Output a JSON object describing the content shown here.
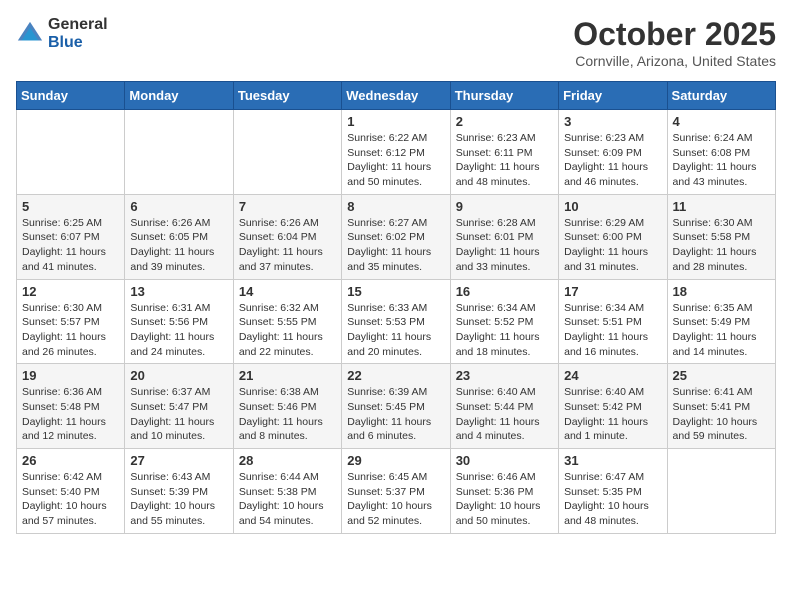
{
  "logo": {
    "general": "General",
    "blue": "Blue"
  },
  "title": "October 2025",
  "location": "Cornville, Arizona, United States",
  "days_of_week": [
    "Sunday",
    "Monday",
    "Tuesday",
    "Wednesday",
    "Thursday",
    "Friday",
    "Saturday"
  ],
  "weeks": [
    [
      {
        "day": "",
        "info": ""
      },
      {
        "day": "",
        "info": ""
      },
      {
        "day": "",
        "info": ""
      },
      {
        "day": "1",
        "info": "Sunrise: 6:22 AM\nSunset: 6:12 PM\nDaylight: 11 hours\nand 50 minutes."
      },
      {
        "day": "2",
        "info": "Sunrise: 6:23 AM\nSunset: 6:11 PM\nDaylight: 11 hours\nand 48 minutes."
      },
      {
        "day": "3",
        "info": "Sunrise: 6:23 AM\nSunset: 6:09 PM\nDaylight: 11 hours\nand 46 minutes."
      },
      {
        "day": "4",
        "info": "Sunrise: 6:24 AM\nSunset: 6:08 PM\nDaylight: 11 hours\nand 43 minutes."
      }
    ],
    [
      {
        "day": "5",
        "info": "Sunrise: 6:25 AM\nSunset: 6:07 PM\nDaylight: 11 hours\nand 41 minutes."
      },
      {
        "day": "6",
        "info": "Sunrise: 6:26 AM\nSunset: 6:05 PM\nDaylight: 11 hours\nand 39 minutes."
      },
      {
        "day": "7",
        "info": "Sunrise: 6:26 AM\nSunset: 6:04 PM\nDaylight: 11 hours\nand 37 minutes."
      },
      {
        "day": "8",
        "info": "Sunrise: 6:27 AM\nSunset: 6:02 PM\nDaylight: 11 hours\nand 35 minutes."
      },
      {
        "day": "9",
        "info": "Sunrise: 6:28 AM\nSunset: 6:01 PM\nDaylight: 11 hours\nand 33 minutes."
      },
      {
        "day": "10",
        "info": "Sunrise: 6:29 AM\nSunset: 6:00 PM\nDaylight: 11 hours\nand 31 minutes."
      },
      {
        "day": "11",
        "info": "Sunrise: 6:30 AM\nSunset: 5:58 PM\nDaylight: 11 hours\nand 28 minutes."
      }
    ],
    [
      {
        "day": "12",
        "info": "Sunrise: 6:30 AM\nSunset: 5:57 PM\nDaylight: 11 hours\nand 26 minutes."
      },
      {
        "day": "13",
        "info": "Sunrise: 6:31 AM\nSunset: 5:56 PM\nDaylight: 11 hours\nand 24 minutes."
      },
      {
        "day": "14",
        "info": "Sunrise: 6:32 AM\nSunset: 5:55 PM\nDaylight: 11 hours\nand 22 minutes."
      },
      {
        "day": "15",
        "info": "Sunrise: 6:33 AM\nSunset: 5:53 PM\nDaylight: 11 hours\nand 20 minutes."
      },
      {
        "day": "16",
        "info": "Sunrise: 6:34 AM\nSunset: 5:52 PM\nDaylight: 11 hours\nand 18 minutes."
      },
      {
        "day": "17",
        "info": "Sunrise: 6:34 AM\nSunset: 5:51 PM\nDaylight: 11 hours\nand 16 minutes."
      },
      {
        "day": "18",
        "info": "Sunrise: 6:35 AM\nSunset: 5:49 PM\nDaylight: 11 hours\nand 14 minutes."
      }
    ],
    [
      {
        "day": "19",
        "info": "Sunrise: 6:36 AM\nSunset: 5:48 PM\nDaylight: 11 hours\nand 12 minutes."
      },
      {
        "day": "20",
        "info": "Sunrise: 6:37 AM\nSunset: 5:47 PM\nDaylight: 11 hours\nand 10 minutes."
      },
      {
        "day": "21",
        "info": "Sunrise: 6:38 AM\nSunset: 5:46 PM\nDaylight: 11 hours\nand 8 minutes."
      },
      {
        "day": "22",
        "info": "Sunrise: 6:39 AM\nSunset: 5:45 PM\nDaylight: 11 hours\nand 6 minutes."
      },
      {
        "day": "23",
        "info": "Sunrise: 6:40 AM\nSunset: 5:44 PM\nDaylight: 11 hours\nand 4 minutes."
      },
      {
        "day": "24",
        "info": "Sunrise: 6:40 AM\nSunset: 5:42 PM\nDaylight: 11 hours\nand 1 minute."
      },
      {
        "day": "25",
        "info": "Sunrise: 6:41 AM\nSunset: 5:41 PM\nDaylight: 10 hours\nand 59 minutes."
      }
    ],
    [
      {
        "day": "26",
        "info": "Sunrise: 6:42 AM\nSunset: 5:40 PM\nDaylight: 10 hours\nand 57 minutes."
      },
      {
        "day": "27",
        "info": "Sunrise: 6:43 AM\nSunset: 5:39 PM\nDaylight: 10 hours\nand 55 minutes."
      },
      {
        "day": "28",
        "info": "Sunrise: 6:44 AM\nSunset: 5:38 PM\nDaylight: 10 hours\nand 54 minutes."
      },
      {
        "day": "29",
        "info": "Sunrise: 6:45 AM\nSunset: 5:37 PM\nDaylight: 10 hours\nand 52 minutes."
      },
      {
        "day": "30",
        "info": "Sunrise: 6:46 AM\nSunset: 5:36 PM\nDaylight: 10 hours\nand 50 minutes."
      },
      {
        "day": "31",
        "info": "Sunrise: 6:47 AM\nSunset: 5:35 PM\nDaylight: 10 hours\nand 48 minutes."
      },
      {
        "day": "",
        "info": ""
      }
    ]
  ]
}
